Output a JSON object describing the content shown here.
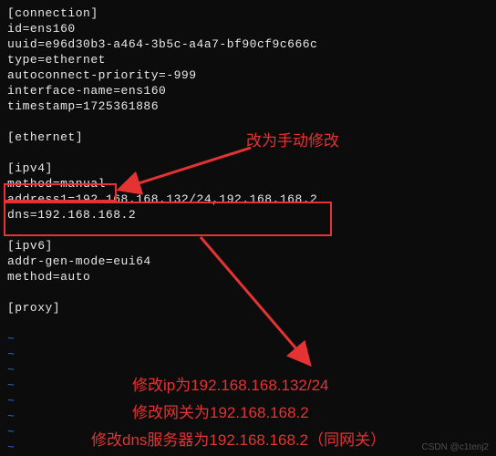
{
  "config": {
    "section_connection": "[connection]",
    "id": "id=ens160",
    "uuid": "uuid=e96d30b3-a464-3b5c-a4a7-bf90cf9c666c",
    "type": "type=ethernet",
    "autoconnect_priority": "autoconnect-priority=-999",
    "interface_name": "interface-name=ens160",
    "timestamp": "timestamp=1725361886",
    "section_ethernet": "[ethernet]",
    "section_ipv4": "[ipv4]",
    "method_ipv4": "method=manual",
    "address1": "address1=192.168.168.132/24,192.168.168.2",
    "dns": "dns=192.168.168.2",
    "section_ipv6": "[ipv6]",
    "addr_gen_mode": "addr-gen-mode=eui64",
    "method_ipv6": "method=auto",
    "section_proxy": "[proxy]"
  },
  "tilde": "~",
  "annotations": {
    "a1": "改为手动修改",
    "a2": "修改ip为192.168.168.132/24",
    "a3": "修改网关为192.168.168.2",
    "a4": "修改dns服务器为192.168.168.2（同网关）"
  },
  "watermark": "CSDN @c1tenj2"
}
